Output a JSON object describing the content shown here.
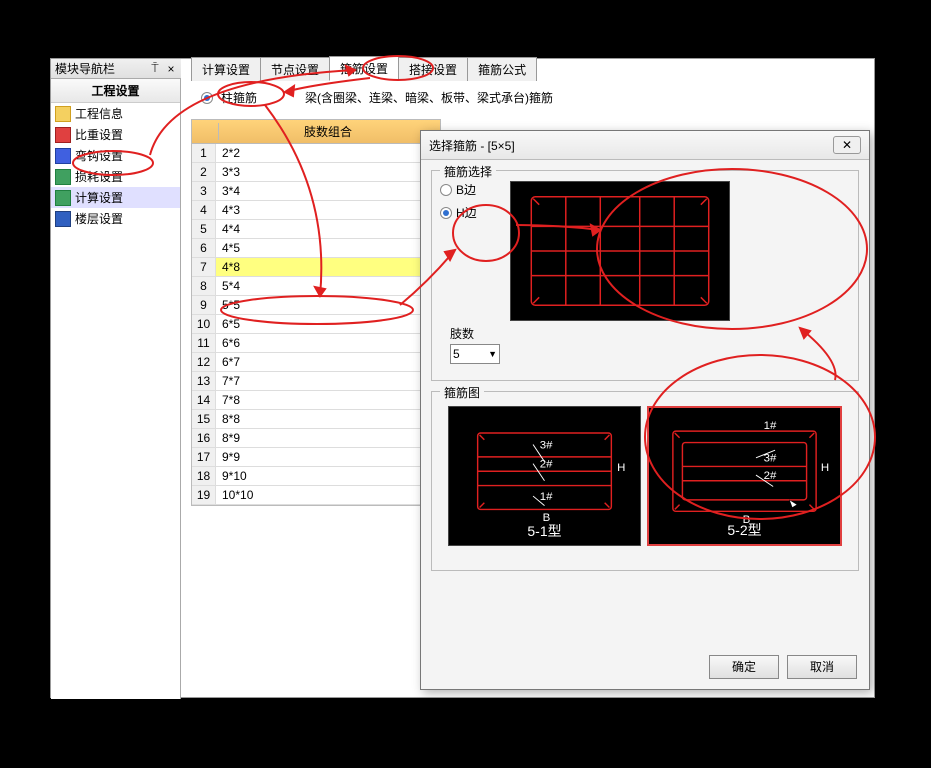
{
  "nav": {
    "panel_title": "模块导航栏",
    "section": "工程设置",
    "items": [
      {
        "label": "工程信息",
        "icon": "folder"
      },
      {
        "label": "比重设置",
        "icon": "red"
      },
      {
        "label": "弯钩设置",
        "icon": "blue"
      },
      {
        "label": "损耗设置",
        "icon": "green"
      },
      {
        "label": "计算设置",
        "icon": "green",
        "selected": true
      },
      {
        "label": "楼层设置",
        "icon": "book"
      }
    ]
  },
  "tabs": {
    "items": [
      "计算设置",
      "节点设置",
      "箍筋设置",
      "搭接设置",
      "箍筋公式"
    ],
    "active": 2
  },
  "type_radio": {
    "opt1": "柱箍筋",
    "opt2": "梁(含圈梁、连梁、暗梁、板带、梁式承台)箍筋",
    "selected": 0
  },
  "grid": {
    "header": "肢数组合",
    "rows": [
      "2*2",
      "3*3",
      "3*4",
      "4*3",
      "4*4",
      "4*5",
      "4*8",
      "5*4",
      "5*5",
      "6*5",
      "6*6",
      "6*7",
      "7*7",
      "7*8",
      "8*8",
      "8*9",
      "9*9",
      "9*10",
      "10*10"
    ],
    "highlight_index": 6,
    "selected_index": 8
  },
  "dialog": {
    "title": "选择箍筋 - [5×5]",
    "group1": "箍筋选择",
    "radio_b": "B边",
    "radio_h": "H边",
    "radio_selected": "H",
    "limbs_label": "肢数",
    "limbs_value": "5",
    "group2": "箍筋图",
    "option1_caption": "5-1型",
    "option2_caption": "5-2型",
    "option_selected": 1,
    "diag_labels": {
      "l1": "1#",
      "l2": "2#",
      "l3": "3#",
      "B": "B",
      "H": "H"
    },
    "ok": "确定",
    "cancel": "取消"
  }
}
